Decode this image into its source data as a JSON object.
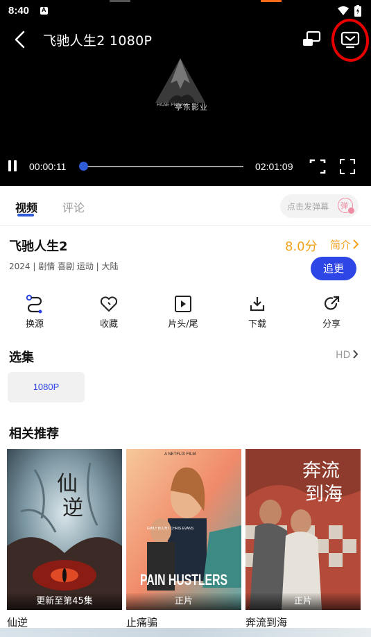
{
  "status_bar": {
    "time": "8:40"
  },
  "player": {
    "title": "飞驰人生2  1080P",
    "logo_text": "亭东影业",
    "logo_small": "PAAE Pictures",
    "current_time": "00:00:11",
    "total_time": "02:01:09",
    "progress": 0.0015
  },
  "tabs": [
    {
      "label": "视频",
      "active": true
    },
    {
      "label": "评论",
      "active": false
    }
  ],
  "danmu": {
    "placeholder": "点击发弹幕"
  },
  "movie": {
    "name": "飞驰人生2",
    "score": "8.0分",
    "intro_label": "简介",
    "meta": "2024 | 剧情 喜剧 运动 | 大陆",
    "follow_label": "追更"
  },
  "actions": [
    {
      "label": "换源",
      "icon": "switch-source-icon"
    },
    {
      "label": "收藏",
      "icon": "heart-icon"
    },
    {
      "label": "片头/尾",
      "icon": "skip-intro-icon"
    },
    {
      "label": "下载",
      "icon": "download-icon"
    },
    {
      "label": "分享",
      "icon": "share-icon"
    }
  ],
  "episodes": {
    "title": "选集",
    "quality_link": "HD",
    "items": [
      "1080P"
    ]
  },
  "recommend": {
    "title": "相关推荐",
    "items": [
      {
        "name": "仙逆",
        "badge": "更新至第45集",
        "poster_text": "仙逆"
      },
      {
        "name": "止痛骗",
        "badge": "正片",
        "poster_text": "PAIN HUSTLERS",
        "poster_top": "A NETFLIX FILM",
        "poster_names": "EMILY BLUNT   CHRIS EVANS"
      },
      {
        "name": "奔流到海",
        "badge": "正片",
        "poster_text": "奔流到海"
      }
    ]
  },
  "colors": {
    "accent": "#2f46e6",
    "score": "#f3a21b",
    "annotation": "#e60000"
  }
}
